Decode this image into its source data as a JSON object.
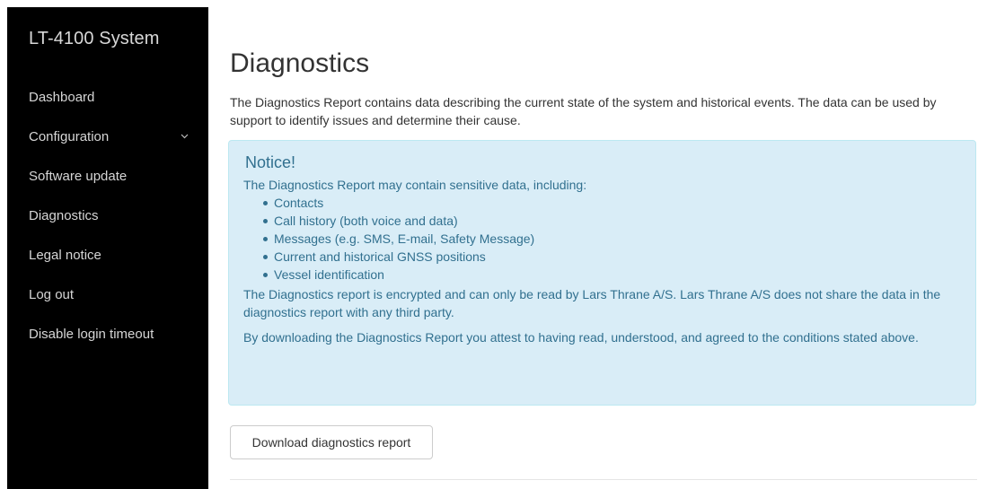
{
  "sidebar": {
    "brand": "LT-4100 System",
    "items": [
      {
        "label": "Dashboard"
      },
      {
        "label": "Configuration",
        "has_submenu": true,
        "icon": "chevron-down-icon"
      },
      {
        "label": "Software update"
      },
      {
        "label": "Diagnostics"
      },
      {
        "label": "Legal notice"
      },
      {
        "label": "Log out"
      },
      {
        "label": "Disable login timeout"
      }
    ]
  },
  "main": {
    "title": "Diagnostics",
    "intro": "The Diagnostics Report contains data describing the current state of the system and historical events. The data can be used by support to identify issues and determine their cause.",
    "notice": {
      "heading": "Notice!",
      "lead": "The Diagnostics Report may contain sensitive data, including:",
      "items": [
        "Contacts",
        "Call history (both voice and data)",
        "Messages (e.g. SMS, E-mail, Safety Message)",
        "Current and historical GNSS positions",
        "Vessel identification"
      ],
      "encryption_text": "The Diagnostics report is encrypted and can only be read by Lars Thrane A/S. Lars Thrane A/S does not share the data in the diagnostics report with any third party.",
      "consent_text": "By downloading the Diagnostics Report you attest to having read, understood, and agreed to the conditions stated above."
    },
    "download_button": "Download diagnostics report"
  },
  "colors": {
    "sidebar_bg": "#000000",
    "notice_bg": "#d9edf7",
    "notice_border": "#bce8f1",
    "notice_text": "#31708f"
  }
}
